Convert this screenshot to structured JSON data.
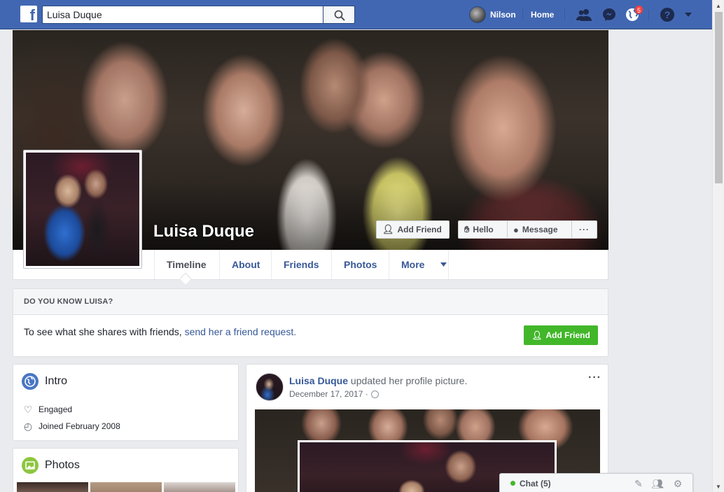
{
  "topbar": {
    "logo": "f",
    "search_value": "Luisa Duque",
    "user_name": "Nilson",
    "home_label": "Home",
    "notifications_count": "5"
  },
  "profile": {
    "name": "Luisa Duque",
    "buttons": {
      "add_friend": "Add Friend",
      "hello": "Hello",
      "message": "Message",
      "more": "···"
    },
    "tabs": [
      "Timeline",
      "About",
      "Friends",
      "Photos",
      "More"
    ],
    "active_tab": "Timeline"
  },
  "know_box": {
    "title": "DO YOU KNOW LUISA?",
    "text": "To see what she shares with friends, ",
    "link": "send her a friend request.",
    "button": "Add Friend"
  },
  "intro": {
    "title": "Intro",
    "items": [
      {
        "icon": "heart-icon",
        "text": "Engaged"
      },
      {
        "icon": "clock-icon",
        "text": "Joined February 2008"
      }
    ]
  },
  "photos": {
    "title": "Photos"
  },
  "post": {
    "author": "Luisa Duque",
    "action": " updated her profile picture.",
    "date": "December 17, 2017 ·",
    "more": "···"
  },
  "chat": {
    "label": "Chat (5)"
  },
  "colors": {
    "brand": "#4267b2",
    "link": "#365899",
    "green": "#42b72a",
    "badge": "#fa3e3e"
  }
}
